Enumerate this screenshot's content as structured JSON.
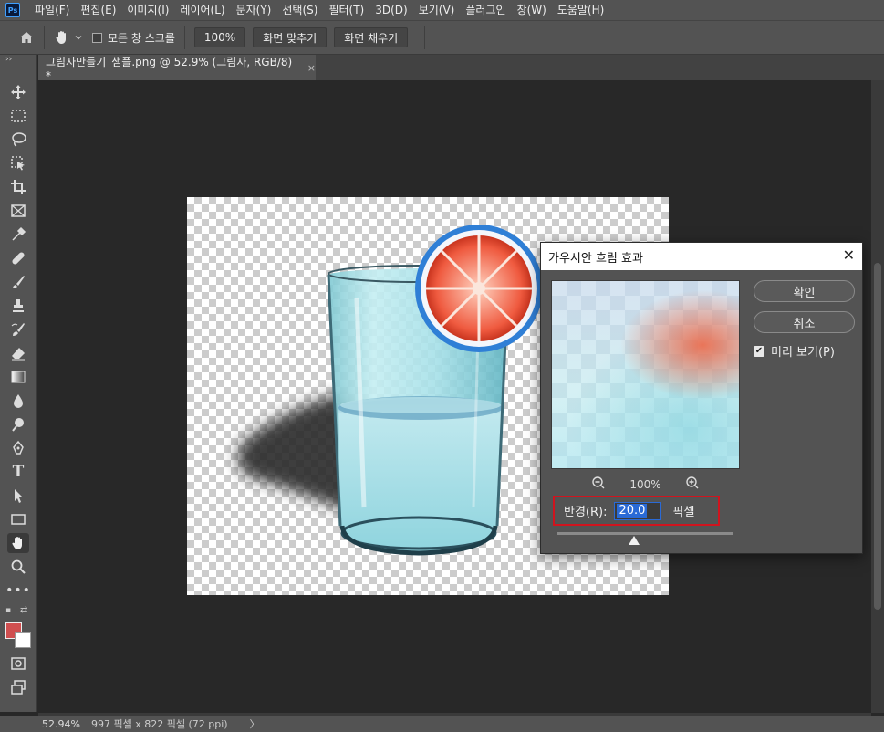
{
  "menu": {
    "logo": "Ps",
    "items": [
      "파일(F)",
      "편집(E)",
      "이미지(I)",
      "레이어(L)",
      "문자(Y)",
      "선택(S)",
      "필터(T)",
      "3D(D)",
      "보기(V)",
      "플러그인",
      "창(W)",
      "도움말(H)"
    ]
  },
  "options": {
    "scroll_all_label": "모든 창 스크롤",
    "zoom_value": "100%",
    "fit_screen_label": "화면 맞추기",
    "fill_screen_label": "화면 채우기"
  },
  "tab": {
    "title": "그림자만들기_샘플.png @ 52.9% (그림자, RGB/8) *",
    "close": "×"
  },
  "dialog": {
    "title": "가우시안 흐림 효과",
    "close": "✕",
    "ok_label": "확인",
    "cancel_label": "취소",
    "preview_label": "미리 보기(P)",
    "preview_checked": true,
    "zoom_level": "100%",
    "radius_label": "반경(R):",
    "radius_value": "20.0",
    "radius_unit": "픽셀",
    "radius_slider_fraction": 0.44
  },
  "status": {
    "zoom": "52.94%",
    "doc_info": "997 픽셀 x 822 픽셀 (72 ppi)",
    "arrow": "〉"
  },
  "colors": {
    "foreground": "#d04f50",
    "background": "#ffffff",
    "highlight_box": "#d0141e"
  }
}
